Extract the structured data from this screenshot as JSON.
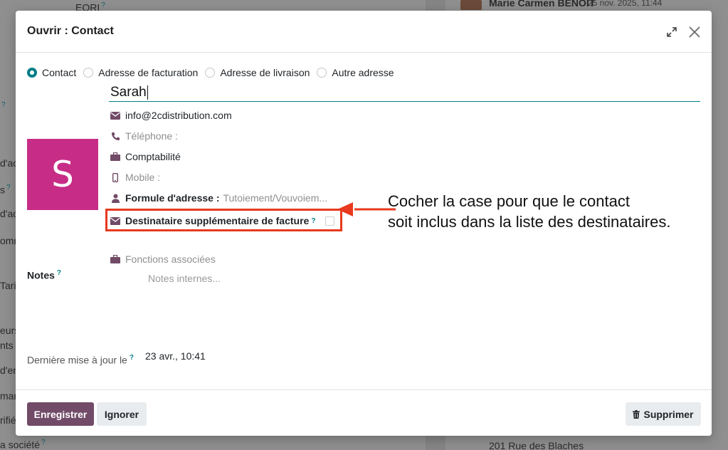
{
  "background": {
    "texts": [
      "EORI",
      "d'ac",
      "s",
      "d'ac",
      "omn",
      "Tarif",
      "eurs",
      "nts",
      "d'en",
      "mar",
      "rifié",
      "a société"
    ],
    "right_top": "Marie Carmen BENOIT",
    "right_top_date": "25 nov. 2025, 11:44",
    "right_bottom": "201 Rue des Blaches",
    "q": "?"
  },
  "modal": {
    "title": "Ouvrir : Contact",
    "radios": [
      {
        "label": "Contact",
        "checked": true
      },
      {
        "label": "Adresse de facturation",
        "checked": false
      },
      {
        "label": "Adresse de livraison",
        "checked": false
      },
      {
        "label": "Autre adresse",
        "checked": false
      }
    ],
    "name": "Sarah",
    "avatar_letter": "S",
    "avatar_color": "#c72d86",
    "email": "info@2cdistribution.com",
    "phone_placeholder": "Téléphone :",
    "function": "Comptabilité",
    "mobile_placeholder": "Mobile :",
    "address_formula_label": "Formule d'adresse :",
    "address_formula_placeholder": "Tutoiement/Vouvoiem...",
    "extra_invoice_label": "Destinataire supplémentaire de facture",
    "extra_invoice_checked": false,
    "functions_placeholder": "Fonctions associées",
    "notes_label": "Notes",
    "notes_placeholder": "Notes internes...",
    "last_update_label": "Dernière mise à jour le",
    "last_update_value": "23 avr., 10:41",
    "tooltip_marker": "?",
    "buttons": {
      "save": "Enregistrer",
      "discard": "Ignorer",
      "delete": "Supprimer"
    }
  },
  "annotation": {
    "line1": "Cocher la case pour que le contact",
    "line2": "soit inclus dans la liste des destinataires."
  },
  "colors": {
    "primary": "#714b67",
    "accent": "#017e84",
    "highlight": "#e8391e"
  }
}
